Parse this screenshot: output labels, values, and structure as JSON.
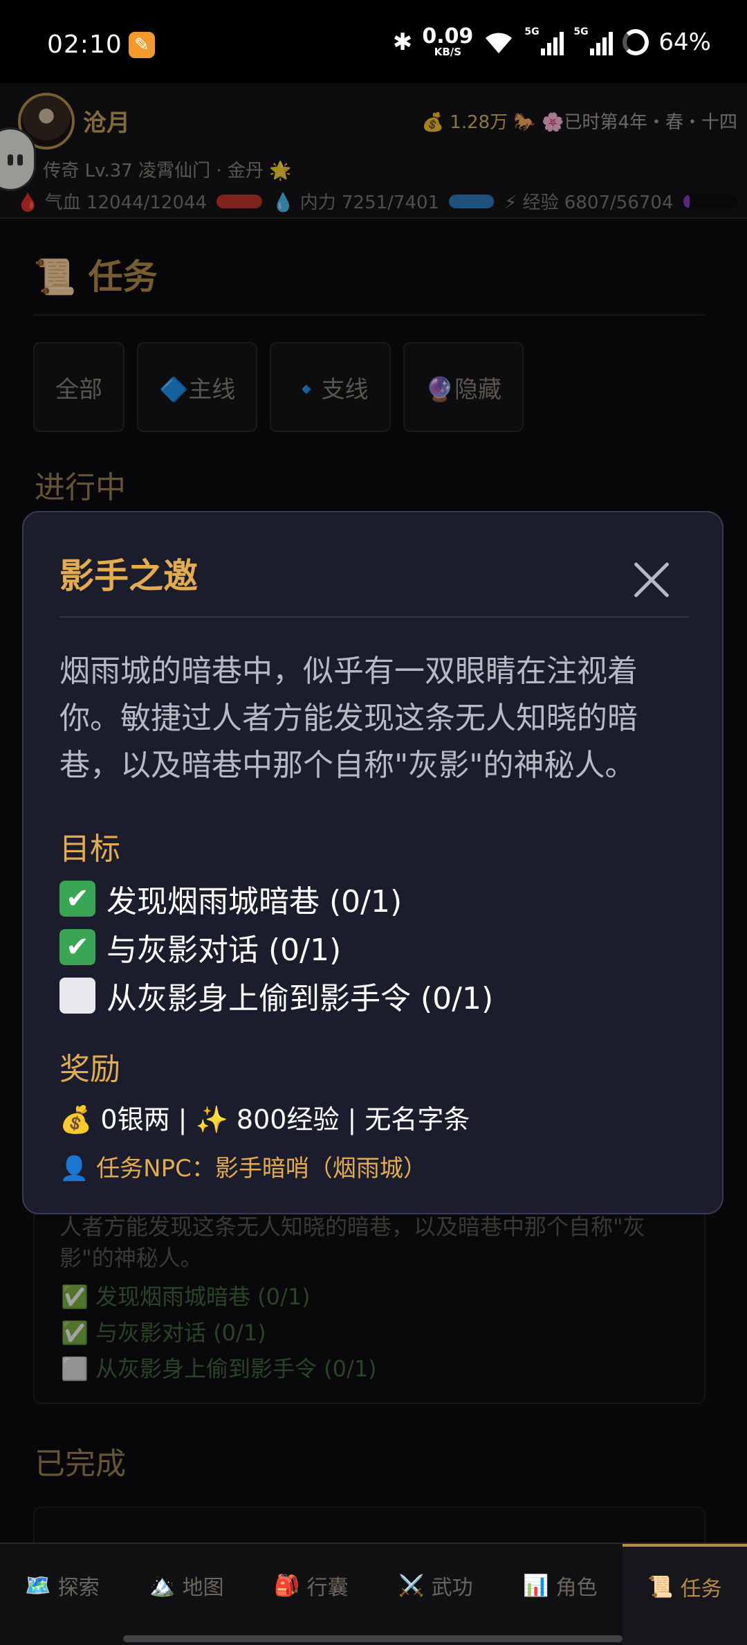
{
  "status_bar": {
    "time": "02:10",
    "net_speed_value": "0.09",
    "net_speed_unit": "KB/S",
    "signal1_tag": "5G",
    "signal2_tag": "5G",
    "battery": "64%",
    "bluetooth_icon": "bluetooth-icon"
  },
  "header": {
    "name": "沧月",
    "money": "💰 1.28万 🐎",
    "date": "🌸已时第4年・春・十四",
    "rank": "🔸传奇 Lv.37 凌霄仙门 · 金丹 🌟",
    "hp": "🩸 气血 12044/12044",
    "mp": "💧 内力 7251/7401",
    "exp": "⚡ 经验 6807/56704",
    "hp_fill": 1.0,
    "mp_fill": 0.98,
    "exp_fill": 0.12,
    "colors": {
      "hp": "#c0392b",
      "mp": "#2f7fc0",
      "exp": "#8a3fc0"
    }
  },
  "page": {
    "title": "📜 任务",
    "filters": [
      "全部",
      "🔷主线",
      "🔹支线",
      "🔮隐藏"
    ],
    "in_progress_label": "进行中",
    "completed_label": "已完成",
    "bg_card": {
      "desc": "人者方能发现这条无人知晓的暗巷，以及暗巷中那个自称\"灰影\"的神秘人。",
      "objectives": [
        "✅ 发现烟雨城暗巷 (0/1)",
        "✅ 与灰影对话 (0/1)",
        "⬜ 从灰影身上偷到影手令 (0/1)"
      ]
    }
  },
  "modal": {
    "title": "影手之邀",
    "description": "烟雨城的暗巷中，似乎有一双眼睛在注视着你。敏捷过人者方能发现这条无人知晓的暗巷，以及暗巷中那个自称\"灰影\"的神秘人。",
    "objectives_label": "目标",
    "objectives": [
      {
        "check": "✔",
        "text": "发现烟雨城暗巷 (0/1)",
        "done": true
      },
      {
        "check": "✔",
        "text": "与灰影对话 (0/1)",
        "done": true
      },
      {
        "check": "",
        "text": "从灰影身上偷到影手令 (0/1)",
        "done": false
      }
    ],
    "rewards_label": "奖励",
    "rewards": "💰 0银两 | ✨ 800经验 | 无名字条",
    "npc": "👤 任务NPC：影手暗哨（烟雨城）"
  },
  "nav": {
    "items": [
      {
        "icon": "🗺️",
        "label": "探索"
      },
      {
        "icon": "🏔️",
        "label": "地图"
      },
      {
        "icon": "🎒",
        "label": "行囊"
      },
      {
        "icon": "⚔️",
        "label": "武功"
      },
      {
        "icon": "📊",
        "label": "角色"
      },
      {
        "icon": "📜",
        "label": "任务"
      }
    ],
    "active_index": 5
  }
}
